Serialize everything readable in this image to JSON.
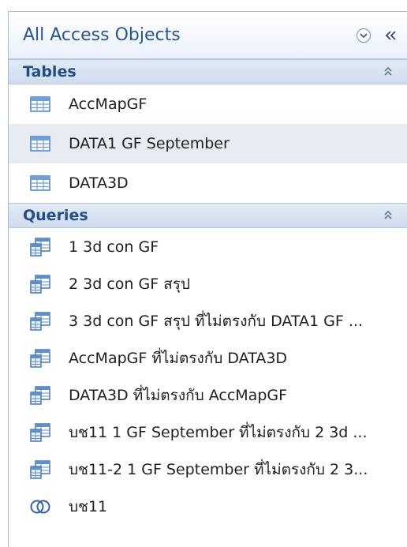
{
  "pane": {
    "title": "All Access Objects"
  },
  "groups": [
    {
      "title": "Tables",
      "items": [
        {
          "label": "AccMapGF",
          "icon": "table-icon"
        },
        {
          "label": "DATA1 GF September",
          "icon": "table-icon"
        },
        {
          "label": "DATA3D",
          "icon": "table-icon"
        }
      ]
    },
    {
      "title": "Queries",
      "items": [
        {
          "label": "1 3d con GF",
          "icon": "select-query-icon"
        },
        {
          "label": "2 3d con GF สรุป",
          "icon": "select-query-icon"
        },
        {
          "label": "3 3d con GF สรุป ที่ไม่ตรงกับ DATA1 GF ...",
          "icon": "select-query-icon"
        },
        {
          "label": "AccMapGF ที่ไม่ตรงกับ DATA3D",
          "icon": "select-query-icon"
        },
        {
          "label": "DATA3D ที่ไม่ตรงกับ AccMapGF",
          "icon": "select-query-icon"
        },
        {
          "label": "บช11 1 GF September ที่ไม่ตรงกับ 2 3d ...",
          "icon": "select-query-icon"
        },
        {
          "label": "บช11-2 1 GF September ที่ไม่ตรงกับ 2 3...",
          "icon": "select-query-icon"
        },
        {
          "label": "บช11",
          "icon": "union-query-icon"
        }
      ]
    }
  ],
  "colors": {
    "title": "#2a5595",
    "group_title": "#1f4e8a",
    "table_icon": "#4a7fc0",
    "query_icon": "#3a6fb0"
  }
}
